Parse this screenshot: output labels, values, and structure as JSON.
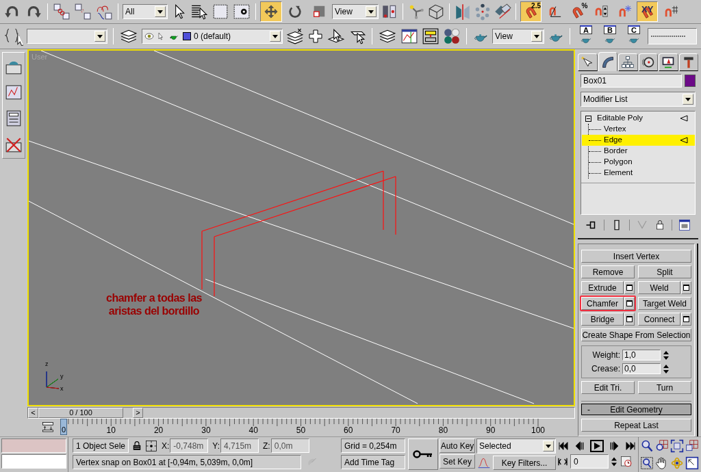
{
  "main_toolbar": {
    "selection_filter": "All",
    "reference_coordinate_system": "View",
    "transform_tools": [
      {
        "kind": "move",
        "selected": true
      },
      {
        "kind": "rotate",
        "selected": false
      },
      {
        "kind": "scale",
        "selected": false
      }
    ],
    "snap_tools": [
      {
        "kind": "magnet",
        "label": "2.5",
        "selected": true
      },
      {
        "kind": "angle",
        "selected": false
      },
      {
        "kind": "magnet",
        "label": "%",
        "selected": false
      },
      {
        "kind": "spinner",
        "selected": false
      },
      {
        "kind": "snowflake",
        "selected": false
      },
      {
        "kind": "constraint",
        "label": "XY",
        "selected": true
      },
      {
        "kind": "grid",
        "selected": false
      }
    ]
  },
  "layer_toolbar": {
    "current_layer": "0 (default)",
    "render_view": "View",
    "teapot_presets": [
      "A",
      "B",
      "C"
    ]
  },
  "viewport": {
    "label": "User",
    "annotation": "chamfer a todas las aristas del bordillo",
    "axes": [
      "z",
      "y",
      "x"
    ]
  },
  "time_slider": {
    "position": "0 / 100",
    "previous": "<",
    "next": ">"
  },
  "track_bar": {
    "current_frame": "0",
    "labels": [
      "10",
      "20",
      "30",
      "40",
      "50",
      "60",
      "70",
      "80",
      "90",
      "100"
    ]
  },
  "command_panel": {
    "tabs": [
      {
        "kind": "create",
        "selected": false
      },
      {
        "kind": "modify",
        "selected": true
      },
      {
        "kind": "hierarchy",
        "selected": false
      },
      {
        "kind": "motion",
        "selected": false
      },
      {
        "kind": "display",
        "selected": false
      },
      {
        "kind": "utilities",
        "selected": false
      }
    ],
    "object": {
      "name": "Box01",
      "color": "#6c0a88"
    },
    "modifier_list": "Modifier List",
    "stack": [
      {
        "label": "Editable Poly",
        "expanded": true,
        "selected": false,
        "children": [
          {
            "label": "Vertex",
            "selected": false
          },
          {
            "label": "Edge",
            "selected": true
          },
          {
            "label": "Border",
            "selected": false
          },
          {
            "label": "Polygon",
            "selected": false
          },
          {
            "label": "Element",
            "selected": false
          }
        ]
      }
    ],
    "edit_edges": {
      "rows": [
        {
          "buttons": [
            {
              "label": "Insert Vertex",
              "settings": false,
              "highlighted": false
            }
          ]
        },
        {
          "buttons": [
            {
              "label": "Remove",
              "settings": false,
              "highlighted": false
            },
            {
              "label": "Split",
              "settings": false,
              "highlighted": false
            }
          ]
        },
        {
          "buttons": [
            {
              "label": "Extrude",
              "settings": true,
              "highlighted": false
            },
            {
              "label": "Weld",
              "settings": true,
              "highlighted": false
            }
          ]
        },
        {
          "buttons": [
            {
              "label": "Chamfer",
              "settings": true,
              "highlighted": true
            },
            {
              "label": "Target Weld",
              "settings": false,
              "highlighted": false
            }
          ]
        },
        {
          "buttons": [
            {
              "label": "Bridge",
              "settings": true,
              "highlighted": false
            },
            {
              "label": "Connect",
              "settings": true,
              "highlighted": false
            }
          ]
        },
        {
          "buttons": [
            {
              "label": "Create Shape From Selection",
              "settings": false,
              "highlighted": false
            }
          ]
        }
      ],
      "spinners": [
        {
          "label": "Weight:",
          "value": "1,0"
        },
        {
          "label": "Crease:",
          "value": "0,0"
        }
      ],
      "bottom_buttons": [
        "Edit Tri.",
        "Turn"
      ]
    },
    "edit_geometry": {
      "toggle": "-",
      "title": "Edit Geometry",
      "buttons": [
        "Repeat Last"
      ]
    }
  },
  "status_bar": {
    "selection": "1 Object Sele",
    "coordinates": [
      {
        "axis": "X:",
        "value": "-0,748m"
      },
      {
        "axis": "Y:",
        "value": "4,715m"
      },
      {
        "axis": "Z:",
        "value": "0,0m"
      }
    ],
    "prompt": "Vertex snap on Box01 at [-0,94m, 5,039m, 0,0m]",
    "grid": "Grid = 0,254m",
    "time_tag": "Add Time Tag",
    "auto_key": {
      "label": "Auto Key",
      "on": false
    },
    "set_key": "Set Key",
    "key_mode": "Selected",
    "key_filters": "Key Filters...",
    "frame": "0"
  }
}
